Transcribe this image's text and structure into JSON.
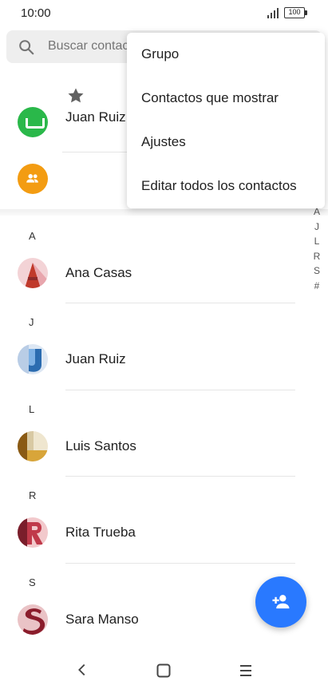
{
  "status_bar": {
    "time": "10:00",
    "battery": "100"
  },
  "search": {
    "placeholder": "Buscar contactos"
  },
  "favorites": {
    "partial_contact_name": "Juan Ruiz"
  },
  "overflow_menu": {
    "items": [
      {
        "label": "Grupo"
      },
      {
        "label": "Contactos que mostrar"
      },
      {
        "label": "Ajustes"
      },
      {
        "label": "Editar todos los contactos"
      }
    ]
  },
  "contacts": {
    "sections": [
      {
        "letter": "A",
        "contacts": [
          {
            "name": "Ana Casas"
          }
        ]
      },
      {
        "letter": "J",
        "contacts": [
          {
            "name": "Juan Ruiz"
          }
        ]
      },
      {
        "letter": "L",
        "contacts": [
          {
            "name": "Luis Santos"
          }
        ]
      },
      {
        "letter": "R",
        "contacts": [
          {
            "name": "Rita Trueba"
          }
        ]
      },
      {
        "letter": "S",
        "contacts": [
          {
            "name": "Sara Manso"
          }
        ]
      }
    ]
  },
  "alpha_index": [
    "A",
    "J",
    "L",
    "R",
    "S",
    "#"
  ],
  "icons": {
    "search": "search-icon",
    "favorites_tab": "star-icon",
    "group": "group-icon",
    "fab": "add-person-icon",
    "nav_back": "back-icon",
    "nav_home": "home-icon",
    "nav_menu": "menu-icon"
  },
  "colors": {
    "accent": "#2979ff",
    "group_avatar": "#f39c12",
    "favorite_avatar": "#2ab84a"
  }
}
